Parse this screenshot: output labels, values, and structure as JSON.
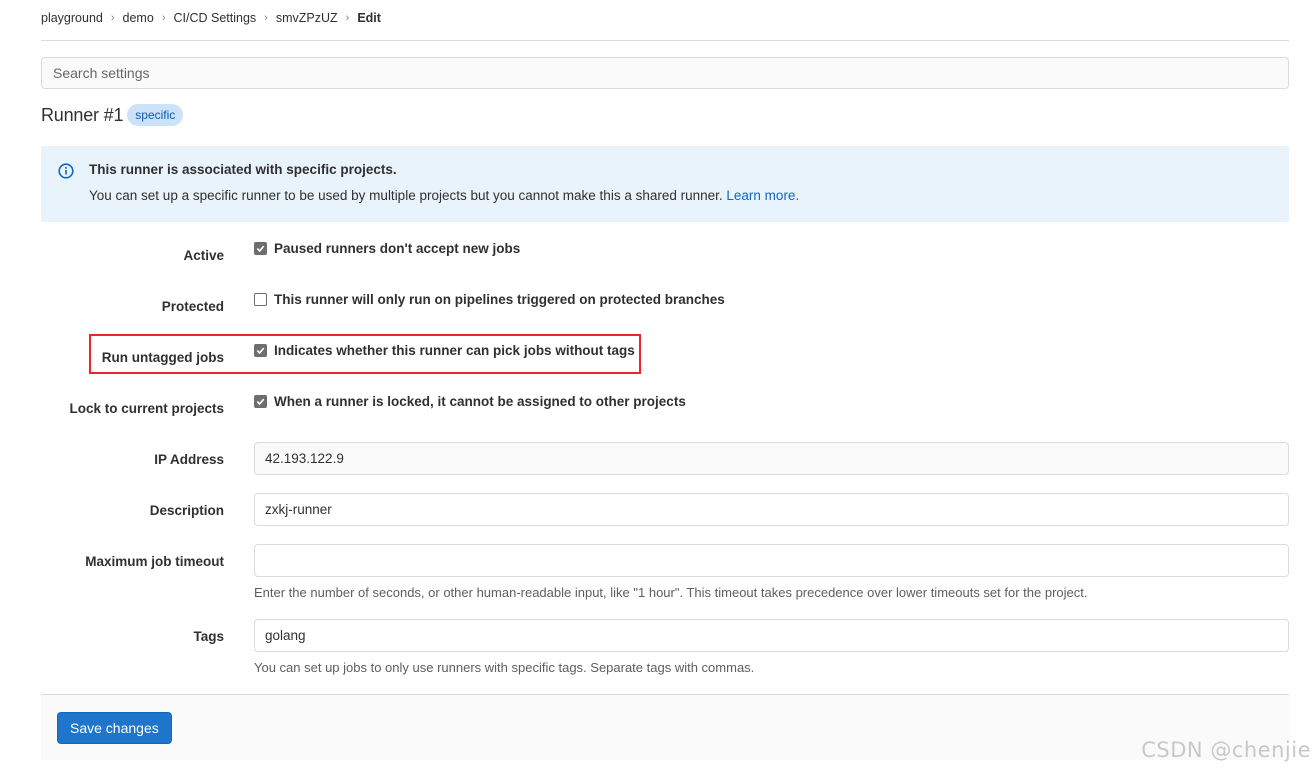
{
  "breadcrumb": {
    "items": [
      {
        "label": "playground"
      },
      {
        "label": "demo"
      },
      {
        "label": "CI/CD Settings"
      },
      {
        "label": "smvZPzUZ"
      },
      {
        "label": "Edit"
      }
    ]
  },
  "search": {
    "placeholder": "Search settings",
    "value": ""
  },
  "runner": {
    "title": "Runner #1",
    "badge": "specific"
  },
  "alert": {
    "icon": "info-icon",
    "title": "This runner is associated with specific projects.",
    "body": "You can set up a specific runner to be used by multiple projects but you cannot make this a shared runner.",
    "link": "Learn more."
  },
  "form": {
    "active": {
      "label": "Active",
      "checkbox_label": "Paused runners don't accept new jobs",
      "checked": true
    },
    "protected": {
      "label": "Protected",
      "checkbox_label": "This runner will only run on pipelines triggered on protected branches",
      "checked": false
    },
    "run_untagged": {
      "label": "Run untagged jobs",
      "checkbox_label": "Indicates whether this runner can pick jobs without tags",
      "checked": true
    },
    "locked": {
      "label": "Lock to current projects",
      "checkbox_label": "When a runner is locked, it cannot be assigned to other projects",
      "checked": true
    },
    "ip_address": {
      "label": "IP Address",
      "value": "42.193.122.9"
    },
    "description": {
      "label": "Description",
      "value": "zxkj-runner"
    },
    "max_timeout": {
      "label": "Maximum job timeout",
      "value": "",
      "help": "Enter the number of seconds, or other human-readable input, like \"1 hour\". This timeout takes precedence over lower timeouts set for the project."
    },
    "tags": {
      "label": "Tags",
      "value": "golang",
      "help": "You can set up jobs to only use runners with specific tags. Separate tags with commas."
    }
  },
  "footer": {
    "save_label": "Save changes"
  },
  "watermark": "CSDN @chenjie",
  "colors": {
    "primary": "#1f75cb",
    "link": "#1068bf",
    "alert_bg": "#e9f3fc",
    "badge_bg": "#cbe2f9",
    "highlight": "#e8262b"
  }
}
